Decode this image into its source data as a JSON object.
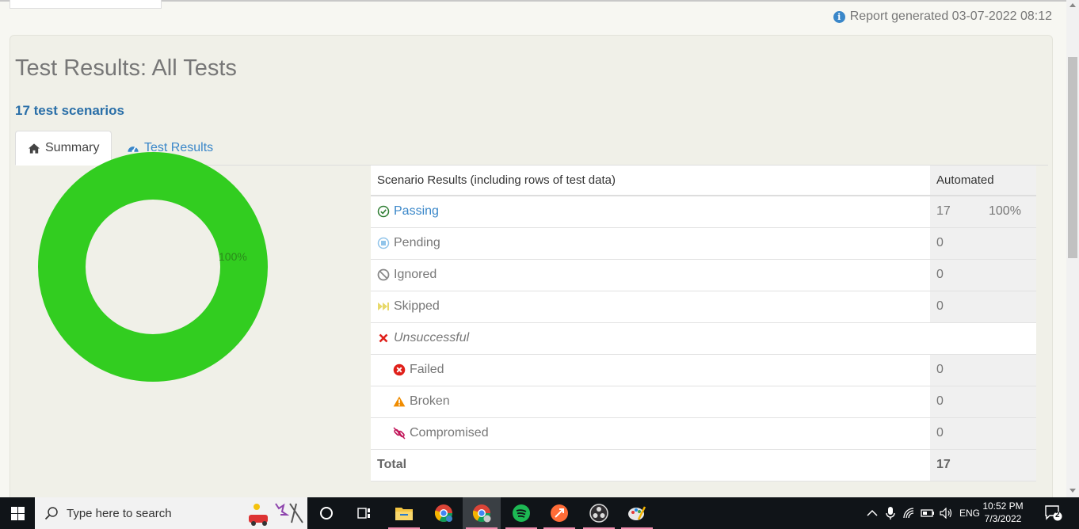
{
  "report": {
    "generated": "Report generated 03-07-2022 08:12"
  },
  "title": "Test Results: All Tests",
  "subtitle": "17 test scenarios",
  "tabs": [
    {
      "label": "Summary",
      "icon": "home-icon",
      "active": true
    },
    {
      "label": "Test Results",
      "icon": "dashboard-icon",
      "active": false
    }
  ],
  "chart_data": {
    "type": "pie",
    "variant": "donut",
    "slices": [
      {
        "label": "Passing",
        "value": 100,
        "color": "#32cd20"
      }
    ],
    "data_label": "100%"
  },
  "table": {
    "header_label": "Scenario Results (including rows of test data)",
    "header_value": "Automated",
    "rows": [
      {
        "label": "Passing",
        "icon": "check-circle-icon",
        "count": "17",
        "percent": "100%"
      },
      {
        "label": "Pending",
        "icon": "pending-icon",
        "count": "0"
      },
      {
        "label": "Ignored",
        "icon": "ban-icon",
        "count": "0"
      },
      {
        "label": "Skipped",
        "icon": "fast-forward-icon",
        "count": "0"
      },
      {
        "label": "Unsuccessful",
        "icon": "x-icon"
      },
      {
        "label": "Failed",
        "icon": "times-circle-icon",
        "count": "0"
      },
      {
        "label": "Broken",
        "icon": "warning-icon",
        "count": "0"
      },
      {
        "label": "Compromised",
        "icon": "broken-link-icon",
        "count": "0"
      },
      {
        "label": "Total",
        "count": "17"
      }
    ]
  },
  "colors": {
    "passing": "#32cd20",
    "link": "#3a87c9",
    "failed": "#e0201a",
    "broken": "#f08c00",
    "compromised": "#c2185b",
    "skipped": "#e8d96a"
  },
  "taskbar": {
    "search_placeholder": "Type here to search",
    "language": "ENG",
    "time": "10:52 PM",
    "date": "7/3/2022",
    "notifications": "2"
  }
}
